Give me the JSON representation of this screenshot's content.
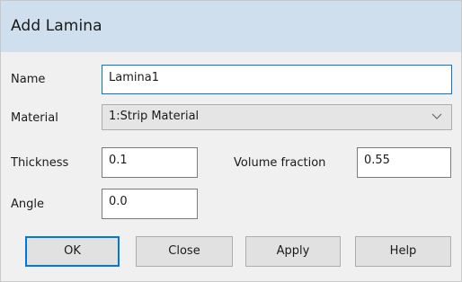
{
  "window": {
    "title": "Add Lamina"
  },
  "form": {
    "name": {
      "label": "Name",
      "value": "Lamina1"
    },
    "material": {
      "label": "Material",
      "selected": "1:Strip Material"
    },
    "thickness": {
      "label": "Thickness",
      "value": "0.1"
    },
    "volume_fraction": {
      "label": "Volume fraction",
      "value": "0.55"
    },
    "angle": {
      "label": "Angle",
      "value": "0.0"
    }
  },
  "buttons": {
    "ok": "OK",
    "close": "Close",
    "apply": "Apply",
    "help": "Help"
  },
  "icons": {
    "material_dropdown": "chevron-down-icon"
  },
  "colors": {
    "titlebar": "#cfdfee",
    "accent": "#0078d7",
    "background": "#f0f0f0"
  }
}
